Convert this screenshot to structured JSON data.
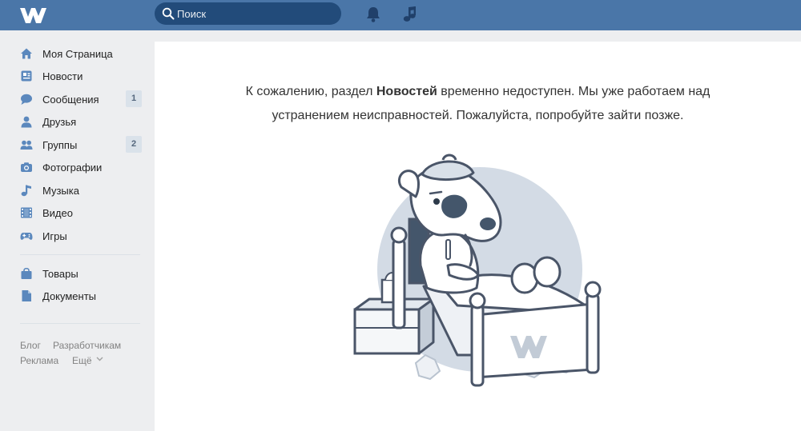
{
  "header": {
    "logo_icon": "vk-logo-icon",
    "search_placeholder": "Поиск",
    "notifications_icon": "bell-icon",
    "music_icon": "music-note-icon",
    "bar_color": "#4a76a8",
    "search_bg": "#224b7a"
  },
  "sidebar": {
    "items": [
      {
        "label": "Моя Страница",
        "icon": "home-icon"
      },
      {
        "label": "Новости",
        "icon": "news-icon"
      },
      {
        "label": "Сообщения",
        "icon": "messages-icon",
        "count": "1"
      },
      {
        "label": "Друзья",
        "icon": "friend-icon"
      },
      {
        "label": "Группы",
        "icon": "groups-icon",
        "count": "2"
      },
      {
        "label": "Фотографии",
        "icon": "camera-icon"
      },
      {
        "label": "Музыка",
        "icon": "music-note-icon"
      },
      {
        "label": "Видео",
        "icon": "film-icon"
      },
      {
        "label": "Игры",
        "icon": "gamepad-icon"
      }
    ],
    "extra_items": [
      {
        "label": "Товары",
        "icon": "shopping-bag-icon"
      },
      {
        "label": "Документы",
        "icon": "document-icon"
      }
    ],
    "footer": {
      "blog": "Блог",
      "developers": "Разработчикам",
      "ads": "Реклама",
      "more": "Ещё"
    }
  },
  "main": {
    "message": {
      "part1": "К сожалению, раздел ",
      "bold": "Новостей",
      "part2": " временно недоступен. Мы уже работаем над",
      "line2": "устранением неисправностей. Пожалуйста, попробуйте зайти позже."
    },
    "illustration": "sick-dog-in-bed-illustration"
  }
}
